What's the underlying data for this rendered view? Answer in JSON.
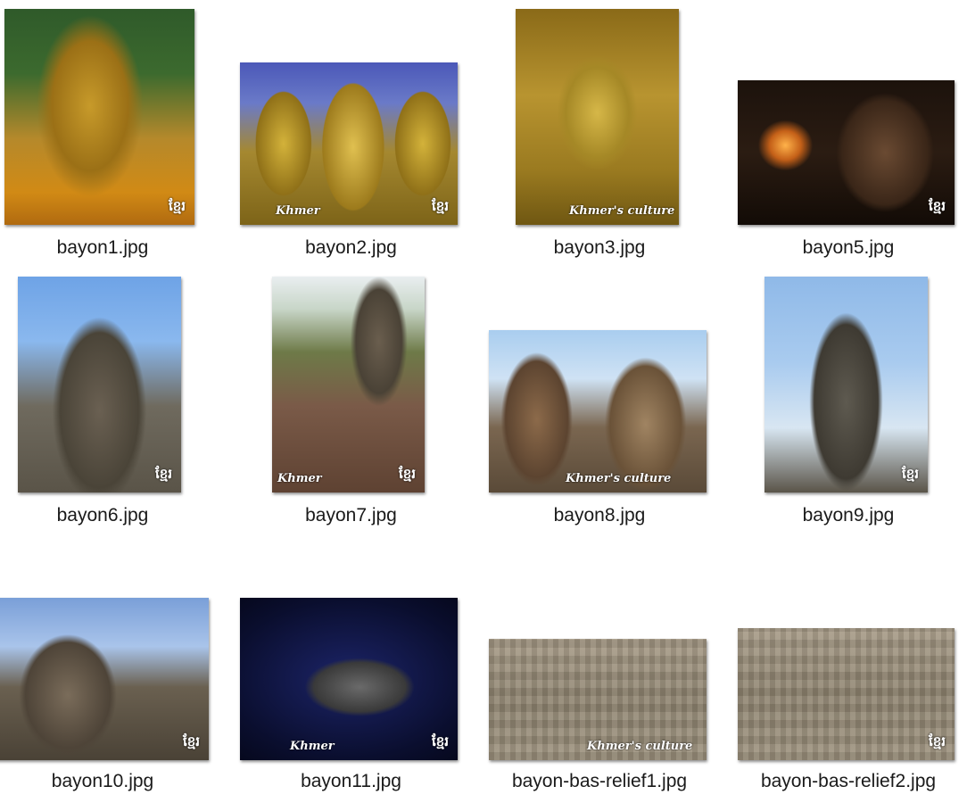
{
  "files": [
    {
      "name": "bayon1.jpg",
      "watermark_logo": "ខ្មែរ",
      "watermark_text": ""
    },
    {
      "name": "bayon2.jpg",
      "watermark_logo": "ខ្មែរ",
      "watermark_text": "Khmer"
    },
    {
      "name": "bayon3.jpg",
      "watermark_logo": "",
      "watermark_text": "Khmer's culture"
    },
    {
      "name": "bayon5.jpg",
      "watermark_logo": "ខ្មែរ",
      "watermark_text": ""
    },
    {
      "name": "bayon6.jpg",
      "watermark_logo": "ខ្មែរ",
      "watermark_text": ""
    },
    {
      "name": "bayon7.jpg",
      "watermark_logo": "ខ្មែរ",
      "watermark_text": "Khmer"
    },
    {
      "name": "bayon8.jpg",
      "watermark_logo": "",
      "watermark_text": "Khmer's culture"
    },
    {
      "name": "bayon9.jpg",
      "watermark_logo": "ខ្មែរ",
      "watermark_text": ""
    },
    {
      "name": "bayon10.jpg",
      "watermark_logo": "ខ្មែរ",
      "watermark_text": ""
    },
    {
      "name": "bayon11.jpg",
      "watermark_logo": "ខ្មែរ",
      "watermark_text": "Khmer"
    },
    {
      "name": "bayon-bas-relief1.jpg",
      "watermark_logo": "",
      "watermark_text": "Khmer's culture"
    },
    {
      "name": "bayon-bas-relief2.jpg",
      "watermark_logo": "ខ្មែរ",
      "watermark_text": ""
    }
  ]
}
